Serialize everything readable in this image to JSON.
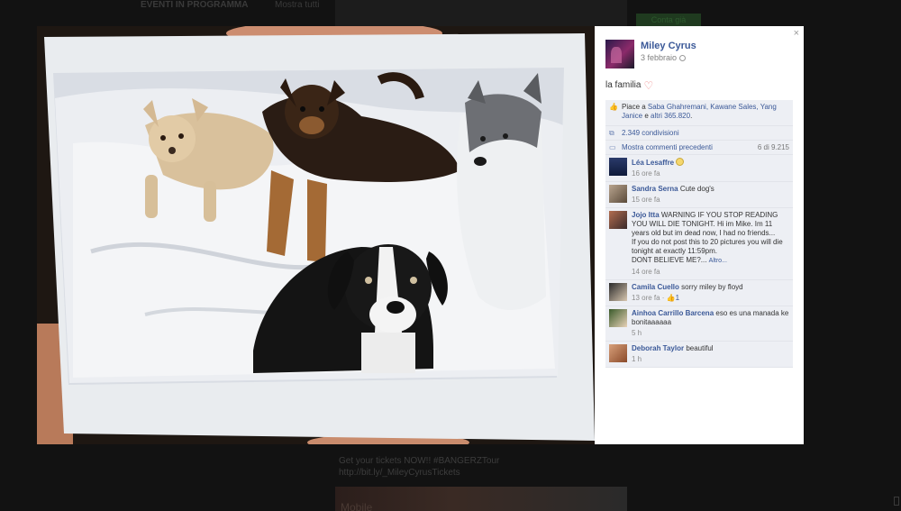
{
  "background": {
    "header_left": "EVENTI IN PROGRAMMA",
    "header_right": "Mostra tutti",
    "green_button": "Conta già Piaciuto",
    "post_line1": "Get your tickets NOW!! #BANGERZTour",
    "post_line2": "http://bit.ly/_MileyCyrusTickets",
    "bottom_banner": "Mobile"
  },
  "photo": {
    "description_icon": "photo-of-four-dogs"
  },
  "panel": {
    "close_label": "×",
    "author": "Miley Cyrus",
    "date": "3 febbraio",
    "caption": "la familia",
    "likes": {
      "prefix": "Piace a ",
      "names": "Saba Ghahremani, Kawane Sales, Yang Janice",
      "joiner": " e ",
      "others": "altri 365.820",
      "suffix": "."
    },
    "shares": "2.349 condivisioni",
    "previous_comments": "Mostra commenti precedenti",
    "previous_count": "6 di 9.215",
    "comments": [
      {
        "name": "Léa Lesaffre",
        "text": "",
        "time": "16 ore fa"
      },
      {
        "name": "Sandra Serna",
        "text": "Cute dog's",
        "time": "15 ore fa"
      },
      {
        "name": "Jojo Itta",
        "text": "WARNING IF YOU STOP READING YOU WILL DIE TONIGHT. Hi im Mike. Im 11 years old but im dead now, I had no friends...",
        "text2": "If you do not post this to 20 pictures you will die tonight at exactly 11:59pm.",
        "text3": "DONT BELIEVE ME?...",
        "more": "Altro...",
        "time": "14 ore fa"
      },
      {
        "name": "Camila Cuello",
        "text": "sorry miley by floyd",
        "time": "13 ore fa",
        "likes": "1"
      },
      {
        "name": "Ainhoa Carrillo Barcena",
        "text": "eso es una manada ke bonitaaaaaa",
        "time": "5 h"
      },
      {
        "name": "Deborah Taylor",
        "text": "beautiful",
        "time": "1 h"
      }
    ],
    "time_sep": " · "
  },
  "colors": {
    "link": "#3b5998",
    "ufi_bg": "#edeff4",
    "overlay": "#121212"
  }
}
